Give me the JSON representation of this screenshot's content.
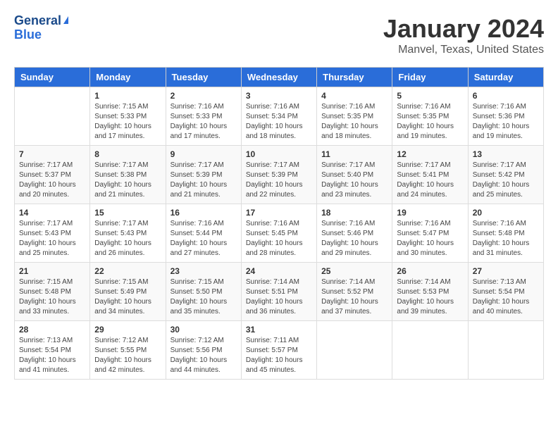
{
  "header": {
    "logo_general": "General",
    "logo_blue": "Blue",
    "month_title": "January 2024",
    "location": "Manvel, Texas, United States"
  },
  "weekdays": [
    "Sunday",
    "Monday",
    "Tuesday",
    "Wednesday",
    "Thursday",
    "Friday",
    "Saturday"
  ],
  "weeks": [
    [
      {
        "day": "",
        "sunrise": "",
        "sunset": "",
        "daylight": ""
      },
      {
        "day": "1",
        "sunrise": "Sunrise: 7:15 AM",
        "sunset": "Sunset: 5:33 PM",
        "daylight": "Daylight: 10 hours and 17 minutes."
      },
      {
        "day": "2",
        "sunrise": "Sunrise: 7:16 AM",
        "sunset": "Sunset: 5:33 PM",
        "daylight": "Daylight: 10 hours and 17 minutes."
      },
      {
        "day": "3",
        "sunrise": "Sunrise: 7:16 AM",
        "sunset": "Sunset: 5:34 PM",
        "daylight": "Daylight: 10 hours and 18 minutes."
      },
      {
        "day": "4",
        "sunrise": "Sunrise: 7:16 AM",
        "sunset": "Sunset: 5:35 PM",
        "daylight": "Daylight: 10 hours and 18 minutes."
      },
      {
        "day": "5",
        "sunrise": "Sunrise: 7:16 AM",
        "sunset": "Sunset: 5:35 PM",
        "daylight": "Daylight: 10 hours and 19 minutes."
      },
      {
        "day": "6",
        "sunrise": "Sunrise: 7:16 AM",
        "sunset": "Sunset: 5:36 PM",
        "daylight": "Daylight: 10 hours and 19 minutes."
      }
    ],
    [
      {
        "day": "7",
        "sunrise": "Sunrise: 7:17 AM",
        "sunset": "Sunset: 5:37 PM",
        "daylight": "Daylight: 10 hours and 20 minutes."
      },
      {
        "day": "8",
        "sunrise": "Sunrise: 7:17 AM",
        "sunset": "Sunset: 5:38 PM",
        "daylight": "Daylight: 10 hours and 21 minutes."
      },
      {
        "day": "9",
        "sunrise": "Sunrise: 7:17 AM",
        "sunset": "Sunset: 5:39 PM",
        "daylight": "Daylight: 10 hours and 21 minutes."
      },
      {
        "day": "10",
        "sunrise": "Sunrise: 7:17 AM",
        "sunset": "Sunset: 5:39 PM",
        "daylight": "Daylight: 10 hours and 22 minutes."
      },
      {
        "day": "11",
        "sunrise": "Sunrise: 7:17 AM",
        "sunset": "Sunset: 5:40 PM",
        "daylight": "Daylight: 10 hours and 23 minutes."
      },
      {
        "day": "12",
        "sunrise": "Sunrise: 7:17 AM",
        "sunset": "Sunset: 5:41 PM",
        "daylight": "Daylight: 10 hours and 24 minutes."
      },
      {
        "day": "13",
        "sunrise": "Sunrise: 7:17 AM",
        "sunset": "Sunset: 5:42 PM",
        "daylight": "Daylight: 10 hours and 25 minutes."
      }
    ],
    [
      {
        "day": "14",
        "sunrise": "Sunrise: 7:17 AM",
        "sunset": "Sunset: 5:43 PM",
        "daylight": "Daylight: 10 hours and 25 minutes."
      },
      {
        "day": "15",
        "sunrise": "Sunrise: 7:17 AM",
        "sunset": "Sunset: 5:43 PM",
        "daylight": "Daylight: 10 hours and 26 minutes."
      },
      {
        "day": "16",
        "sunrise": "Sunrise: 7:16 AM",
        "sunset": "Sunset: 5:44 PM",
        "daylight": "Daylight: 10 hours and 27 minutes."
      },
      {
        "day": "17",
        "sunrise": "Sunrise: 7:16 AM",
        "sunset": "Sunset: 5:45 PM",
        "daylight": "Daylight: 10 hours and 28 minutes."
      },
      {
        "day": "18",
        "sunrise": "Sunrise: 7:16 AM",
        "sunset": "Sunset: 5:46 PM",
        "daylight": "Daylight: 10 hours and 29 minutes."
      },
      {
        "day": "19",
        "sunrise": "Sunrise: 7:16 AM",
        "sunset": "Sunset: 5:47 PM",
        "daylight": "Daylight: 10 hours and 30 minutes."
      },
      {
        "day": "20",
        "sunrise": "Sunrise: 7:16 AM",
        "sunset": "Sunset: 5:48 PM",
        "daylight": "Daylight: 10 hours and 31 minutes."
      }
    ],
    [
      {
        "day": "21",
        "sunrise": "Sunrise: 7:15 AM",
        "sunset": "Sunset: 5:48 PM",
        "daylight": "Daylight: 10 hours and 33 minutes."
      },
      {
        "day": "22",
        "sunrise": "Sunrise: 7:15 AM",
        "sunset": "Sunset: 5:49 PM",
        "daylight": "Daylight: 10 hours and 34 minutes."
      },
      {
        "day": "23",
        "sunrise": "Sunrise: 7:15 AM",
        "sunset": "Sunset: 5:50 PM",
        "daylight": "Daylight: 10 hours and 35 minutes."
      },
      {
        "day": "24",
        "sunrise": "Sunrise: 7:14 AM",
        "sunset": "Sunset: 5:51 PM",
        "daylight": "Daylight: 10 hours and 36 minutes."
      },
      {
        "day": "25",
        "sunrise": "Sunrise: 7:14 AM",
        "sunset": "Sunset: 5:52 PM",
        "daylight": "Daylight: 10 hours and 37 minutes."
      },
      {
        "day": "26",
        "sunrise": "Sunrise: 7:14 AM",
        "sunset": "Sunset: 5:53 PM",
        "daylight": "Daylight: 10 hours and 39 minutes."
      },
      {
        "day": "27",
        "sunrise": "Sunrise: 7:13 AM",
        "sunset": "Sunset: 5:54 PM",
        "daylight": "Daylight: 10 hours and 40 minutes."
      }
    ],
    [
      {
        "day": "28",
        "sunrise": "Sunrise: 7:13 AM",
        "sunset": "Sunset: 5:54 PM",
        "daylight": "Daylight: 10 hours and 41 minutes."
      },
      {
        "day": "29",
        "sunrise": "Sunrise: 7:12 AM",
        "sunset": "Sunset: 5:55 PM",
        "daylight": "Daylight: 10 hours and 42 minutes."
      },
      {
        "day": "30",
        "sunrise": "Sunrise: 7:12 AM",
        "sunset": "Sunset: 5:56 PM",
        "daylight": "Daylight: 10 hours and 44 minutes."
      },
      {
        "day": "31",
        "sunrise": "Sunrise: 7:11 AM",
        "sunset": "Sunset: 5:57 PM",
        "daylight": "Daylight: 10 hours and 45 minutes."
      },
      {
        "day": "",
        "sunrise": "",
        "sunset": "",
        "daylight": ""
      },
      {
        "day": "",
        "sunrise": "",
        "sunset": "",
        "daylight": ""
      },
      {
        "day": "",
        "sunrise": "",
        "sunset": "",
        "daylight": ""
      }
    ]
  ]
}
